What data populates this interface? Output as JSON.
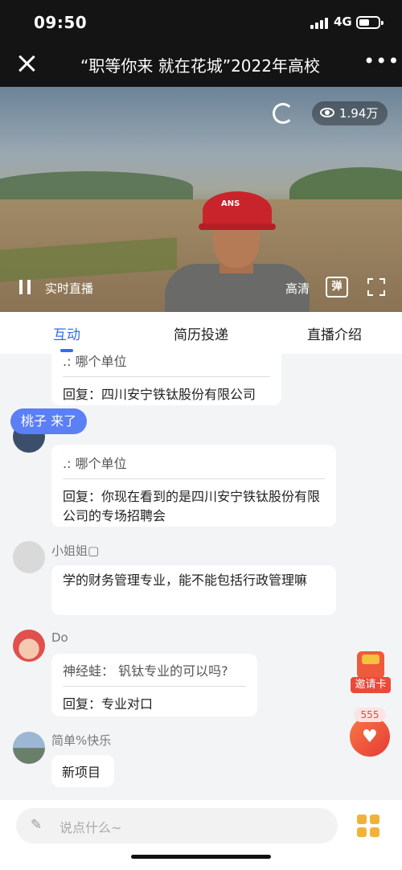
{
  "status": {
    "time": "09:50",
    "network": "4G"
  },
  "header": {
    "title": "“职等你来 就在花城”2022年高校"
  },
  "video": {
    "viewers": "1.94万",
    "live_label": "实时直播",
    "quality": "高清",
    "danmu_label": "弹",
    "helmet_text": "ANS"
  },
  "tabs": [
    {
      "label": "互动"
    },
    {
      "label": "简历投递"
    },
    {
      "label": "直播介绍"
    }
  ],
  "chat": {
    "msg1": {
      "question": ".: 哪个单位",
      "answer": "回复：四川安宁铁钛股份有限公司"
    },
    "join_notice": "桃子 来了",
    "msg2": {
      "question": ".: 哪个单位",
      "answer": "回复：你现在看到的是四川安宁铁钛股份有限公司的专场招聘会"
    },
    "msg3": {
      "user": "小姐姐▢",
      "text": "学的财务管理专业，能不能包括行政管理嘛"
    },
    "msg4": {
      "user": "Do",
      "question": "神经蛙：  钒钛专业的可以吗?",
      "answer": "回复：专业对口"
    },
    "msg5": {
      "user": "简单%快乐",
      "text": "新项目"
    }
  },
  "side": {
    "invite_label": "邀请卡",
    "like_count": "555"
  },
  "input": {
    "placeholder": "说点什么~"
  }
}
